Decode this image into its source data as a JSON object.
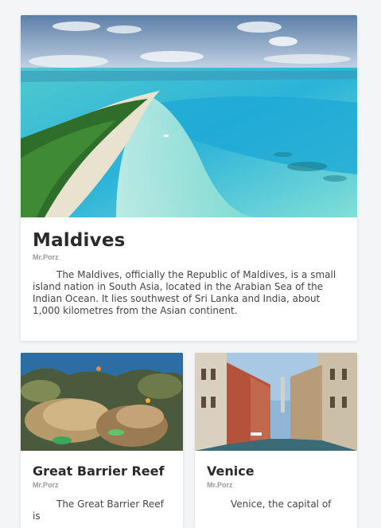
{
  "cards": [
    {
      "title": "Maldives",
      "author": "Mr.Porz",
      "description": "The Maldives, officially the Republic of Maldives, is a small island nation in South Asia, located in the Arabian Sea of the Indian Ocean. It lies southwest of Sri Lanka and India, about 1,000 kilometres from the Asian continent.",
      "image": "maldives-beach-aerial-photo"
    },
    {
      "title": "Great Barrier Reef",
      "author": "Mr.Porz",
      "description": "The Great Barrier Reef is",
      "image": "coral-reef-underwater-photo"
    },
    {
      "title": "Venice",
      "author": "Mr.Porz",
      "description": "Venice, the capital of",
      "image": "venice-canal-photo"
    }
  ],
  "colors": {
    "background": "#f4f5f7",
    "card": "#ffffff",
    "title": "#2b2b2b",
    "author": "#9a9a9a"
  }
}
